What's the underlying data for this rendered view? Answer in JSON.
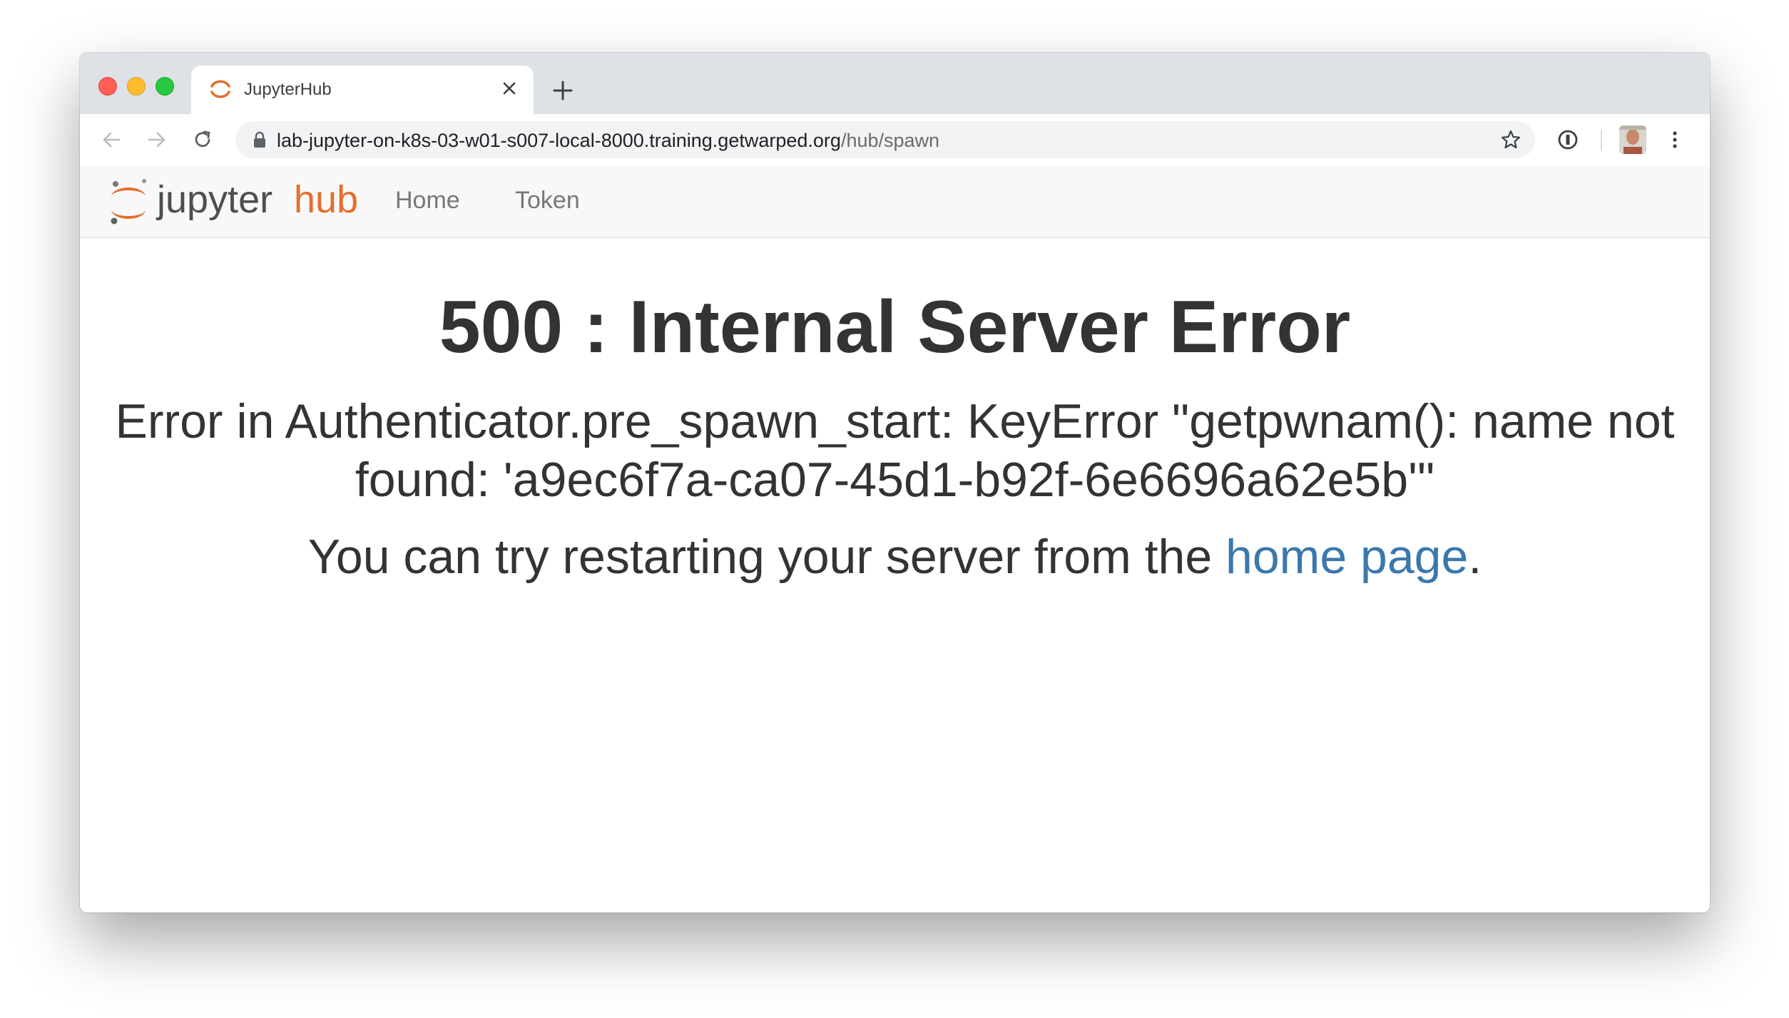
{
  "browser": {
    "tab": {
      "title": "JupyterHub"
    },
    "address_bar": {
      "url_host": "lab-jupyter-on-k8s-03-w01-s007-local-8000.training.getwarped.org",
      "url_path": "/hub/spawn"
    },
    "icons": {
      "back": "arrow-left-icon",
      "forward": "arrow-right-icon",
      "reload": "reload-icon",
      "lock": "lock-icon",
      "bookmark": "star-icon",
      "extension": "password-manager-icon",
      "menu": "more-vertical-icon",
      "close_tab": "close-icon",
      "new_tab": "plus-icon"
    }
  },
  "navbar": {
    "logo_text_main": "jupyter",
    "logo_text_accent": "hub",
    "links": [
      {
        "label": "Home"
      },
      {
        "label": "Token"
      }
    ]
  },
  "error": {
    "title": "500 : Internal Server Error",
    "message": "Error in Authenticator.pre_spawn_start: KeyError \"getpwnam(): name not found: 'a9ec6f7a-ca07-45d1-b92f-6e6696a62e5b'\"",
    "hint_prefix": "You can try restarting your server from the ",
    "hint_link": "home page",
    "hint_suffix": "."
  },
  "colors": {
    "jupyter_orange": "#e46e2e",
    "link_blue": "#3a78ad",
    "text_dark": "#333333",
    "nav_text": "#777777"
  }
}
